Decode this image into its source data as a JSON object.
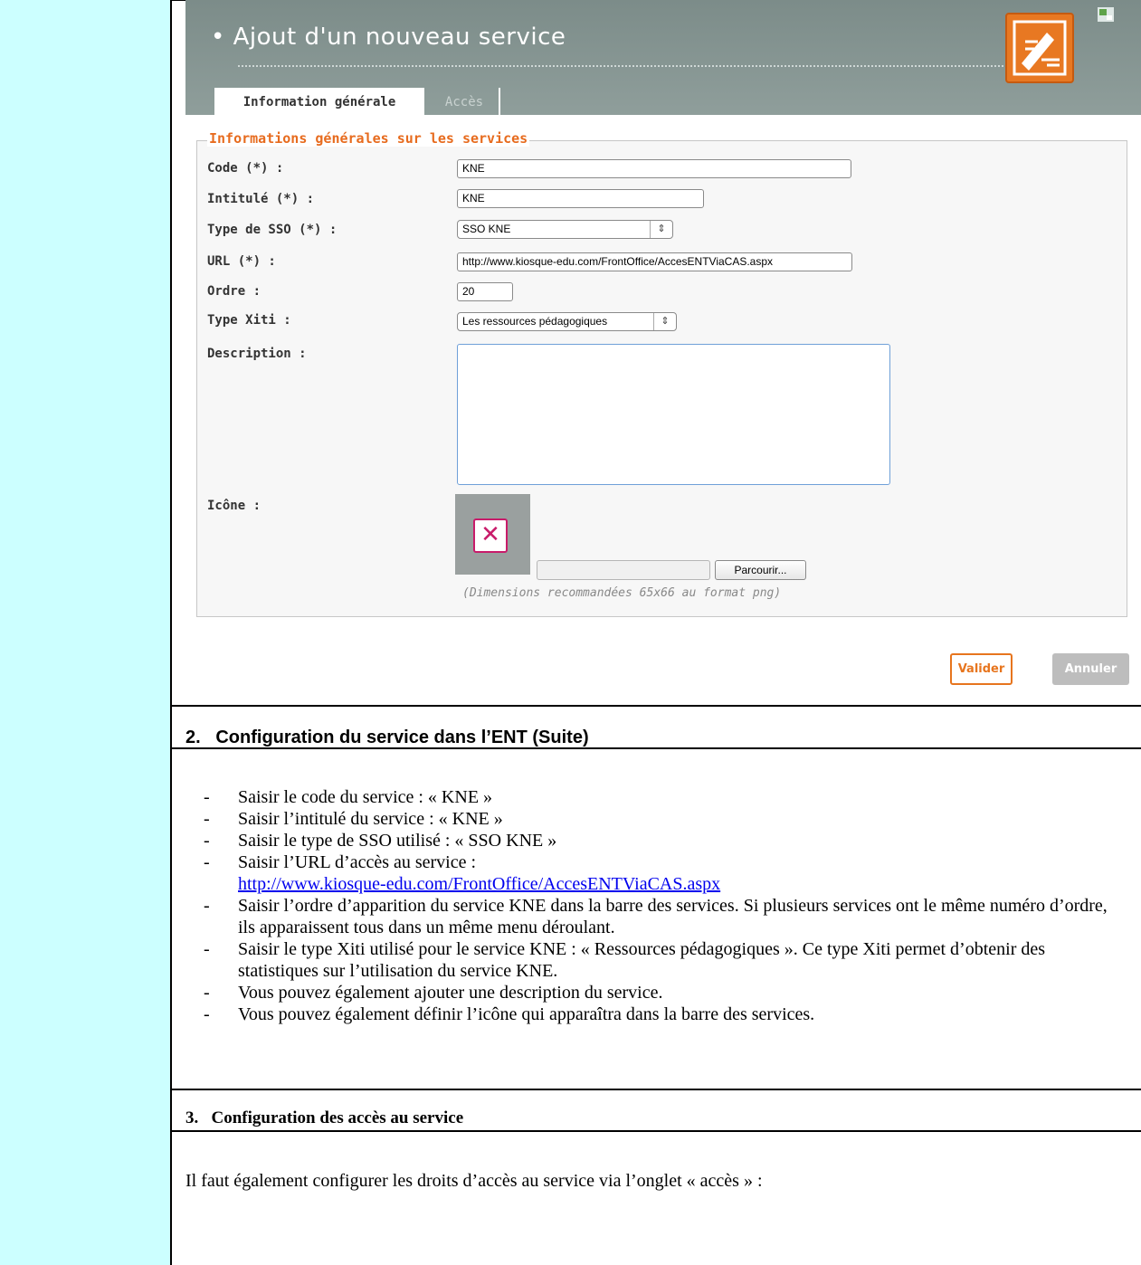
{
  "screenshot": {
    "title": "• Ajout d'un nouveau service",
    "tabs": [
      {
        "label": "Information générale",
        "active": true
      },
      {
        "label": "Accès",
        "active": false
      }
    ],
    "legend": "Informations générales sur les services",
    "fields": {
      "code": {
        "label": "Code (*) :",
        "value": "KNE"
      },
      "intitule": {
        "label": "Intitulé (*) :",
        "value": "KNE"
      },
      "sso": {
        "label": "Type de SSO (*) :",
        "value": "SSO KNE"
      },
      "url": {
        "label": "URL (*) :",
        "value": "http://www.kiosque-edu.com/FrontOffice/AccesENTViaCAS.aspx"
      },
      "ordre": {
        "label": "Ordre :",
        "value": "20"
      },
      "xiti": {
        "label": "Type Xiti :",
        "value": "Les ressources pédagogiques"
      },
      "description": {
        "label": "Description :",
        "value": ""
      },
      "icone": {
        "label": "Icône :"
      }
    },
    "browse_label": "Parcourir...",
    "dimensions_note": "(Dimensions recommandées 65x66 au format png)",
    "buttons": {
      "valider": "Valider",
      "annuler": "Annuler"
    },
    "colors": {
      "accent": "#e7751e",
      "header": "#8a9a97",
      "icon_placeholder": "#c81b6a"
    }
  },
  "section2": {
    "title": "2.   Configuration du service dans l’ENT (Suite)",
    "bullets": [
      "Saisir le code du service : « KNE »",
      "Saisir l’intitulé du service : « KNE »",
      "Saisir le type de SSO utilisé : « SSO KNE »",
      "Saisir l’URL d’accès au service :",
      "Saisir l’ordre d’apparition du service KNE dans la barre des services. Si plusieurs services ont le même numéro d’ordre, ils apparaissent tous dans un même menu déroulant.",
      "Saisir le type Xiti utilisé pour le service KNE : « Ressources pédagogiques ». Ce type Xiti permet d’obtenir des statistiques sur l’utilisation du service KNE.",
      "Vous pouvez également ajouter une description du service.",
      "Vous pouvez également définir l’icône qui apparaîtra dans la barre des services."
    ],
    "url_link": "http://www.kiosque-edu.com/FrontOffice/AccesENTViaCAS.aspx"
  },
  "section3": {
    "title": "3.   Configuration des accès au service",
    "paragraph": "Il faut également configurer les droits d’accès au service via l’onglet « accès » :"
  }
}
